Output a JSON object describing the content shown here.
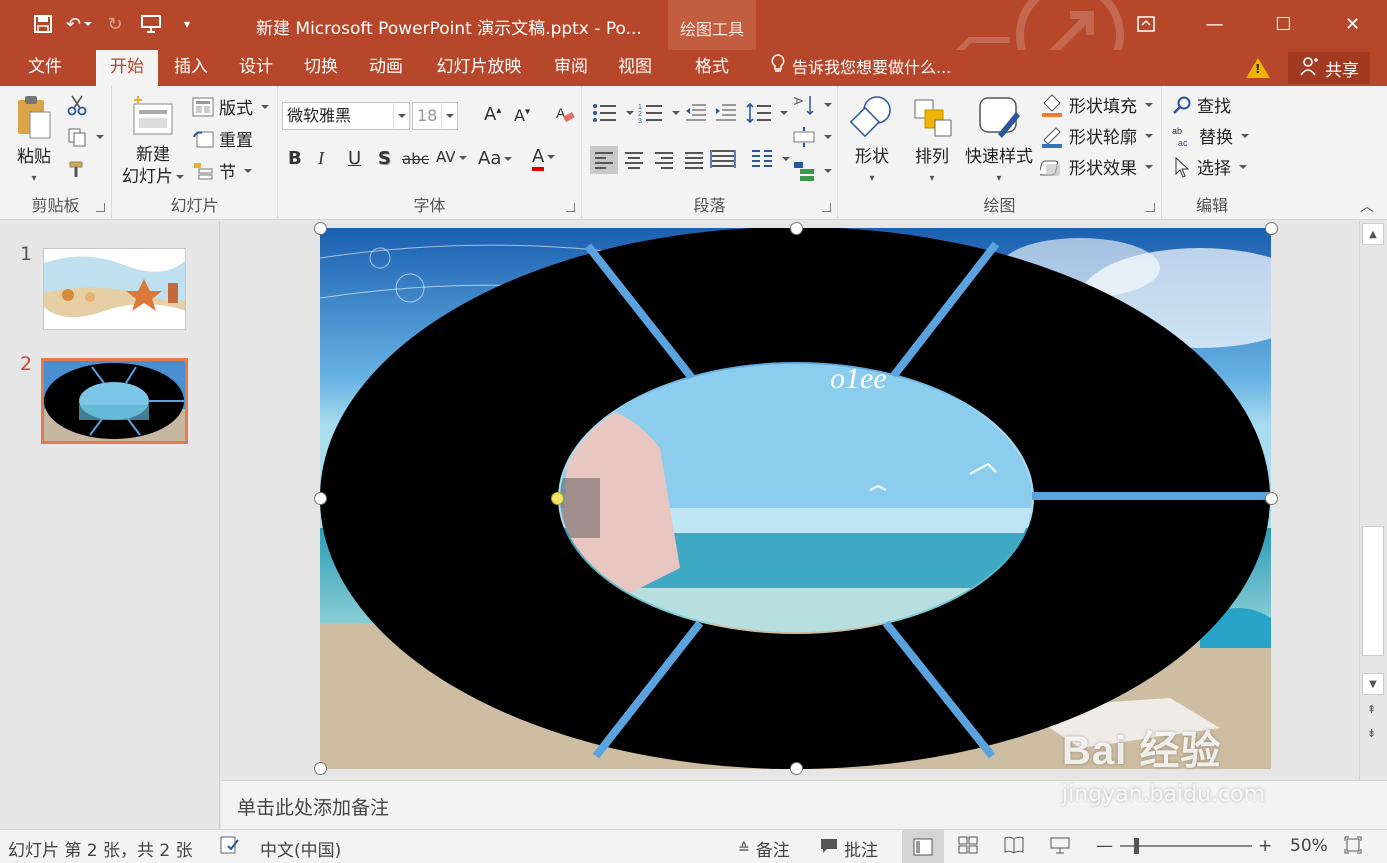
{
  "app": {
    "document_title": "新建 Microsoft PowerPoint 演示文稿.pptx - Po...",
    "context_tab": "绘图工具"
  },
  "tabs": [
    {
      "label": "文件",
      "active": false
    },
    {
      "label": "开始",
      "active": true
    },
    {
      "label": "插入",
      "active": false
    },
    {
      "label": "设计",
      "active": false
    },
    {
      "label": "切换",
      "active": false
    },
    {
      "label": "动画",
      "active": false
    },
    {
      "label": "幻灯片放映",
      "active": false
    },
    {
      "label": "审阅",
      "active": false
    },
    {
      "label": "视图",
      "active": false
    },
    {
      "label": "格式",
      "active": false
    }
  ],
  "tell_me": "告诉我您想要做什么...",
  "share": "共享",
  "ribbon": {
    "clipboard": {
      "paste": "粘贴",
      "label": "剪贴板"
    },
    "slides": {
      "new_slide_1": "新建",
      "new_slide_2": "幻灯片",
      "layout": "版式",
      "reset": "重置",
      "section": "节",
      "label": "幻灯片"
    },
    "font": {
      "name": "微软雅黑",
      "size": "18",
      "label": "字体",
      "bold": "B",
      "italic": "I",
      "underline": "U",
      "shadow": "S",
      "strike": "abc",
      "spacing": "AV",
      "case": "Aa",
      "color": "A"
    },
    "paragraph": {
      "label": "段落"
    },
    "drawing": {
      "shapes": "形状",
      "arrange": "排列",
      "quick_styles": "快速样式",
      "fill": "形状填充",
      "outline": "形状轮廓",
      "effects": "形状效果",
      "label": "绘图"
    },
    "editing": {
      "find": "查找",
      "replace": "替换",
      "select": "选择",
      "label": "编辑"
    }
  },
  "thumbnails": [
    {
      "number": "1",
      "active": false
    },
    {
      "number": "2",
      "active": true
    }
  ],
  "notes_placeholder": "单击此处添加备注",
  "statusbar": {
    "slide_info": "幻灯片 第 2 张，共 2 张",
    "language": "中文(中国)",
    "notes": "备注",
    "comments": "批注",
    "zoom": "50%"
  },
  "watermark": {
    "brand": "Bai 经验",
    "url": "jingyan.baidu.com"
  },
  "colors": {
    "accent": "#b7472a",
    "active_thumb": "#e4794f",
    "shape_fill": "#000000"
  }
}
